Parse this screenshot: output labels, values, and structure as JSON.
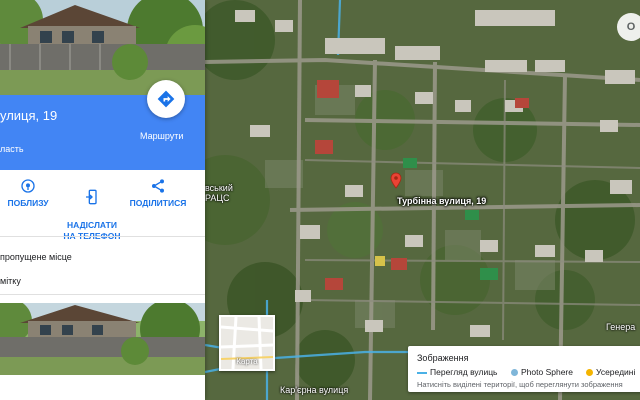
{
  "place": {
    "address_fragment": "улиця, 19",
    "subtitle_fragment": "ласть"
  },
  "directions": {
    "label": "Маршрути"
  },
  "actions": [
    {
      "label": "ПОБЛИЗУ",
      "icon": "location-icon"
    },
    {
      "label": "НАДІСЛАТИ\nНА ТЕЛЕФОН",
      "icon": "send-to-phone-icon"
    },
    {
      "label": "ПОДІЛИТИСЯ",
      "icon": "share-icon"
    }
  ],
  "links": {
    "missing_place": "пропущене місце",
    "label": "мітку"
  },
  "map": {
    "pin_label": "Турбінна вулиця, 19",
    "poi_label_line1": "вський",
    "poi_label_line2": "РАЦС",
    "street_bottom": "Кар'єрна вулиця",
    "street_right": "Генера",
    "corner_badge": "O"
  },
  "minimap": {
    "label": "Карта"
  },
  "legend": {
    "title": "Зображення",
    "items": [
      {
        "label": "Перегляд вулиць",
        "color": "#4ab1e6"
      },
      {
        "label": "Photo Sphere",
        "color": "#7fb6d9"
      },
      {
        "label": "Усередині",
        "color": "#f4b400"
      }
    ],
    "hint": "Натисніть виділені території, щоб переглянути зображення"
  },
  "colors": {
    "accent": "#4285f4",
    "action_blue": "#1a73e8",
    "pin_red": "#ea4335"
  }
}
